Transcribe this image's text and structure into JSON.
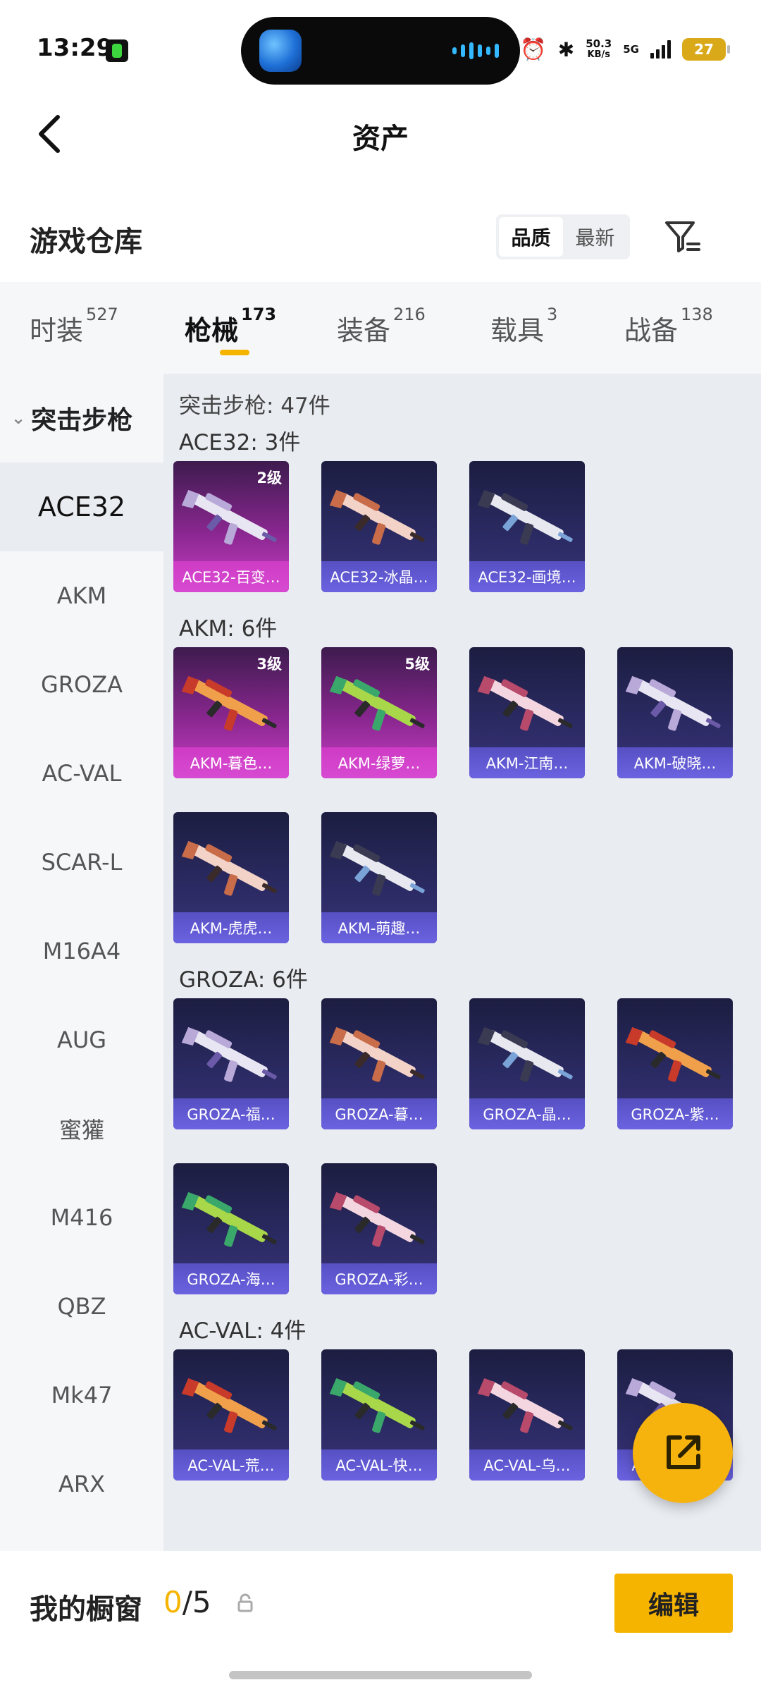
{
  "status_bar": {
    "time": "13:29",
    "network_speed": "50.3",
    "network_unit": "KB/s",
    "network_type": "5G",
    "battery": "27"
  },
  "header": {
    "title": "资产"
  },
  "warehouse": {
    "title": "游戏仓库",
    "sort_options": [
      "品质",
      "最新"
    ],
    "active_sort": "品质"
  },
  "tabs": [
    {
      "label": "时装",
      "count": "527"
    },
    {
      "label": "枪械",
      "count": "173"
    },
    {
      "label": "装备",
      "count": "216"
    },
    {
      "label": "载具",
      "count": "3"
    },
    {
      "label": "战备",
      "count": "138"
    }
  ],
  "active_tab": "枪械",
  "sidebar": {
    "group": "突击步枪",
    "items": [
      "ACE32",
      "AKM",
      "GROZA",
      "AC-VAL",
      "SCAR-L",
      "M16A4",
      "AUG",
      "蜜獾",
      "M416",
      "QBZ",
      "Mk47",
      "ARX"
    ],
    "active": "ACE32"
  },
  "main": {
    "group_total": "突击步枪: 47件",
    "sections": [
      {
        "title": "ACE32: 3件",
        "cards": [
          {
            "name": "ACE32-百变…",
            "level": "2级",
            "rarity": "gold"
          },
          {
            "name": "ACE32-冰晶…",
            "level": "",
            "rarity": "purple"
          },
          {
            "name": "ACE32-画境…",
            "level": "",
            "rarity": "purple"
          }
        ]
      },
      {
        "title": "AKM: 6件",
        "cards": [
          {
            "name": "AKM-暮色…",
            "level": "3级",
            "rarity": "gold"
          },
          {
            "name": "AKM-绿萝…",
            "level": "5级",
            "rarity": "gold"
          },
          {
            "name": "AKM-江南…",
            "level": "",
            "rarity": "purple"
          },
          {
            "name": "AKM-破晓…",
            "level": "",
            "rarity": "purple"
          },
          {
            "name": "AKM-虎虎…",
            "level": "",
            "rarity": "purple"
          },
          {
            "name": "AKM-萌趣…",
            "level": "",
            "rarity": "purple"
          }
        ]
      },
      {
        "title": "GROZA: 6件",
        "cards": [
          {
            "name": "GROZA-福…",
            "level": "",
            "rarity": "purple"
          },
          {
            "name": "GROZA-暮…",
            "level": "",
            "rarity": "purple"
          },
          {
            "name": "GROZA-晶…",
            "level": "",
            "rarity": "purple"
          },
          {
            "name": "GROZA-紫…",
            "level": "",
            "rarity": "purple"
          },
          {
            "name": "GROZA-海…",
            "level": "",
            "rarity": "purple"
          },
          {
            "name": "GROZA-彩…",
            "level": "",
            "rarity": "purple"
          }
        ]
      },
      {
        "title": "AC-VAL: 4件",
        "cards": [
          {
            "name": "AC-VAL-荒…",
            "level": "",
            "rarity": "purple"
          },
          {
            "name": "AC-VAL-快…",
            "level": "",
            "rarity": "purple"
          },
          {
            "name": "AC-VAL-乌…",
            "level": "",
            "rarity": "purple"
          },
          {
            "name": "AC-VAL-天…",
            "level": "",
            "rarity": "purple"
          }
        ]
      }
    ]
  },
  "bottom_bar": {
    "title": "我的橱窗",
    "current": "0",
    "total": "/5",
    "edit_label": "编辑"
  },
  "colors": {
    "accent": "#f5b400",
    "card_purple": "#2a2a62",
    "card_gold": "#c93fc4"
  },
  "icons": {
    "back": "chevron-left-icon",
    "filter": "filter-icon",
    "share": "share-icon",
    "lock": "lock-icon"
  }
}
